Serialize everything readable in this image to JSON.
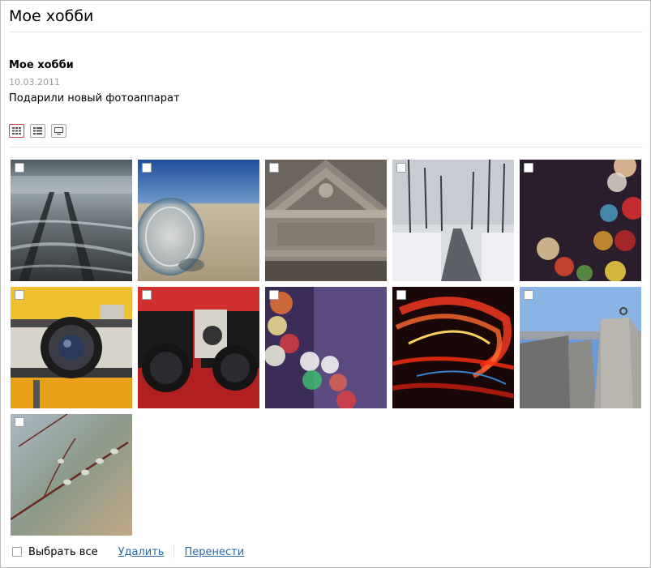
{
  "page": {
    "title": "Мое хобби"
  },
  "album": {
    "title": "Мое хобби",
    "date": "10.03.2011",
    "description": "Подарили новый фотоаппарат"
  },
  "view_modes": {
    "items": [
      {
        "name": "grid-large-icon",
        "active": true
      },
      {
        "name": "grid-list-icon",
        "active": false
      },
      {
        "name": "single-view-icon",
        "active": false
      }
    ]
  },
  "photos": [
    {
      "subject": "wet-rails"
    },
    {
      "subject": "glass-jar-on-sand"
    },
    {
      "subject": "stone-pediment"
    },
    {
      "subject": "snowy-park-path"
    },
    {
      "subject": "bokeh-lights"
    },
    {
      "subject": "vintage-camera"
    },
    {
      "subject": "canon-cameras"
    },
    {
      "subject": "bokeh-lights-purple"
    },
    {
      "subject": "red-light-trails"
    },
    {
      "subject": "concrete-pier"
    },
    {
      "subject": "willow-branch"
    }
  ],
  "footer": {
    "select_all": "Выбрать все",
    "delete": "Удалить",
    "move": "Перенести"
  },
  "colors": {
    "accent_active": "#c4413b",
    "link": "#2a67a8",
    "date": "#9a9a9a"
  }
}
